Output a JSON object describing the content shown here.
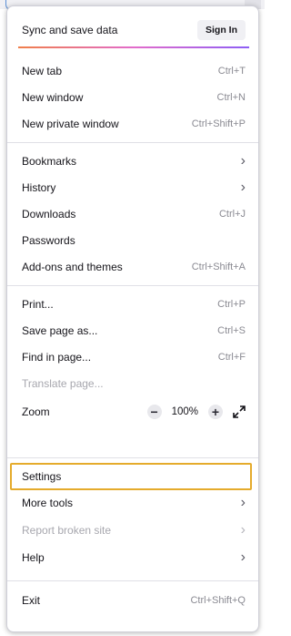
{
  "header": {
    "sync_label": "Sync and save data",
    "signin_label": "Sign In"
  },
  "items": {
    "new_tab": {
      "label": "New tab",
      "shortcut": "Ctrl+T"
    },
    "new_window": {
      "label": "New window",
      "shortcut": "Ctrl+N"
    },
    "new_private_window": {
      "label": "New private window",
      "shortcut": "Ctrl+Shift+P"
    },
    "bookmarks": {
      "label": "Bookmarks",
      "icon": "chevron-right-icon"
    },
    "history": {
      "label": "History",
      "icon": "chevron-right-icon"
    },
    "downloads": {
      "label": "Downloads",
      "shortcut": "Ctrl+J"
    },
    "passwords": {
      "label": "Passwords"
    },
    "addons": {
      "label": "Add-ons and themes",
      "shortcut": "Ctrl+Shift+A"
    },
    "print": {
      "label": "Print...",
      "shortcut": "Ctrl+P"
    },
    "save_page": {
      "label": "Save page as...",
      "shortcut": "Ctrl+S"
    },
    "find_in_page": {
      "label": "Find in page...",
      "shortcut": "Ctrl+F"
    },
    "translate_page": {
      "label": "Translate page...",
      "disabled": true
    },
    "zoom": {
      "label": "Zoom",
      "minus": "−",
      "value": "100%",
      "plus": "+",
      "fullscreen_icon": "expand-icon"
    },
    "settings": {
      "label": "Settings",
      "highlighted": true
    },
    "more_tools": {
      "label": "More tools",
      "icon": "chevron-right-icon"
    },
    "report_broken_site": {
      "label": "Report broken site",
      "disabled": true
    },
    "help": {
      "label": "Help",
      "icon": "chevron-right-icon"
    },
    "exit": {
      "label": "Exit",
      "shortcut": "Ctrl+Shift+Q"
    }
  },
  "colors": {
    "highlight_border": "#e5ab2c",
    "accent_gradient": [
      "#f07f4a",
      "#e26ccb",
      "#8d5ef5"
    ],
    "disabled_text": "#a7a7ae"
  }
}
